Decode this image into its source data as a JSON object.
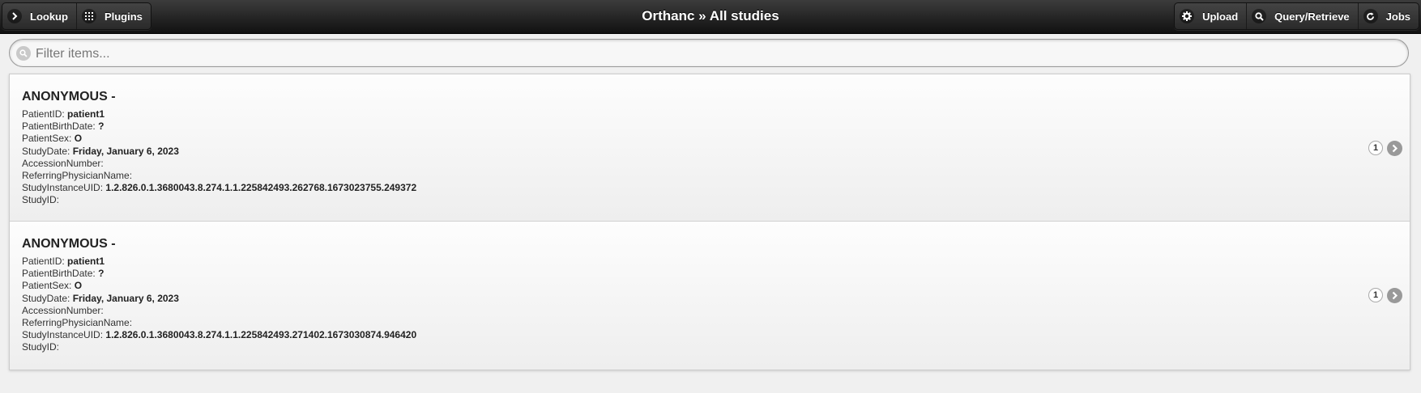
{
  "header": {
    "title": "Orthanc » All studies",
    "left_buttons": [
      {
        "label": "Lookup",
        "icon": "chevron-right-icon"
      },
      {
        "label": "Plugins",
        "icon": "grid-icon"
      }
    ],
    "right_buttons": [
      {
        "label": "Upload",
        "icon": "gear-icon"
      },
      {
        "label": "Query/Retrieve",
        "icon": "search-icon"
      },
      {
        "label": "Jobs",
        "icon": "refresh-icon"
      }
    ]
  },
  "filter": {
    "placeholder": "Filter items...",
    "value": ""
  },
  "field_labels": {
    "patient_id": "PatientID:",
    "birth_date": "PatientBirthDate:",
    "sex": "PatientSex:",
    "study_date": "StudyDate:",
    "accession": "AccessionNumber:",
    "referring": "ReferringPhysicianName:",
    "study_uid": "StudyInstanceUID:",
    "study_id": "StudyID:"
  },
  "studies": [
    {
      "name": "ANONYMOUS -",
      "patient_id": "patient1",
      "birth_date": "?",
      "sex": "O",
      "study_date": "Friday, January 6, 2023",
      "accession": "",
      "referring": "",
      "study_uid": "1.2.826.0.1.3680043.8.274.1.1.225842493.262768.1673023755.249372",
      "study_id": "",
      "count": "1"
    },
    {
      "name": "ANONYMOUS -",
      "patient_id": "patient1",
      "birth_date": "?",
      "sex": "O",
      "study_date": "Friday, January 6, 2023",
      "accession": "",
      "referring": "",
      "study_uid": "1.2.826.0.1.3680043.8.274.1.1.225842493.271402.1673030874.946420",
      "study_id": "",
      "count": "1"
    }
  ]
}
